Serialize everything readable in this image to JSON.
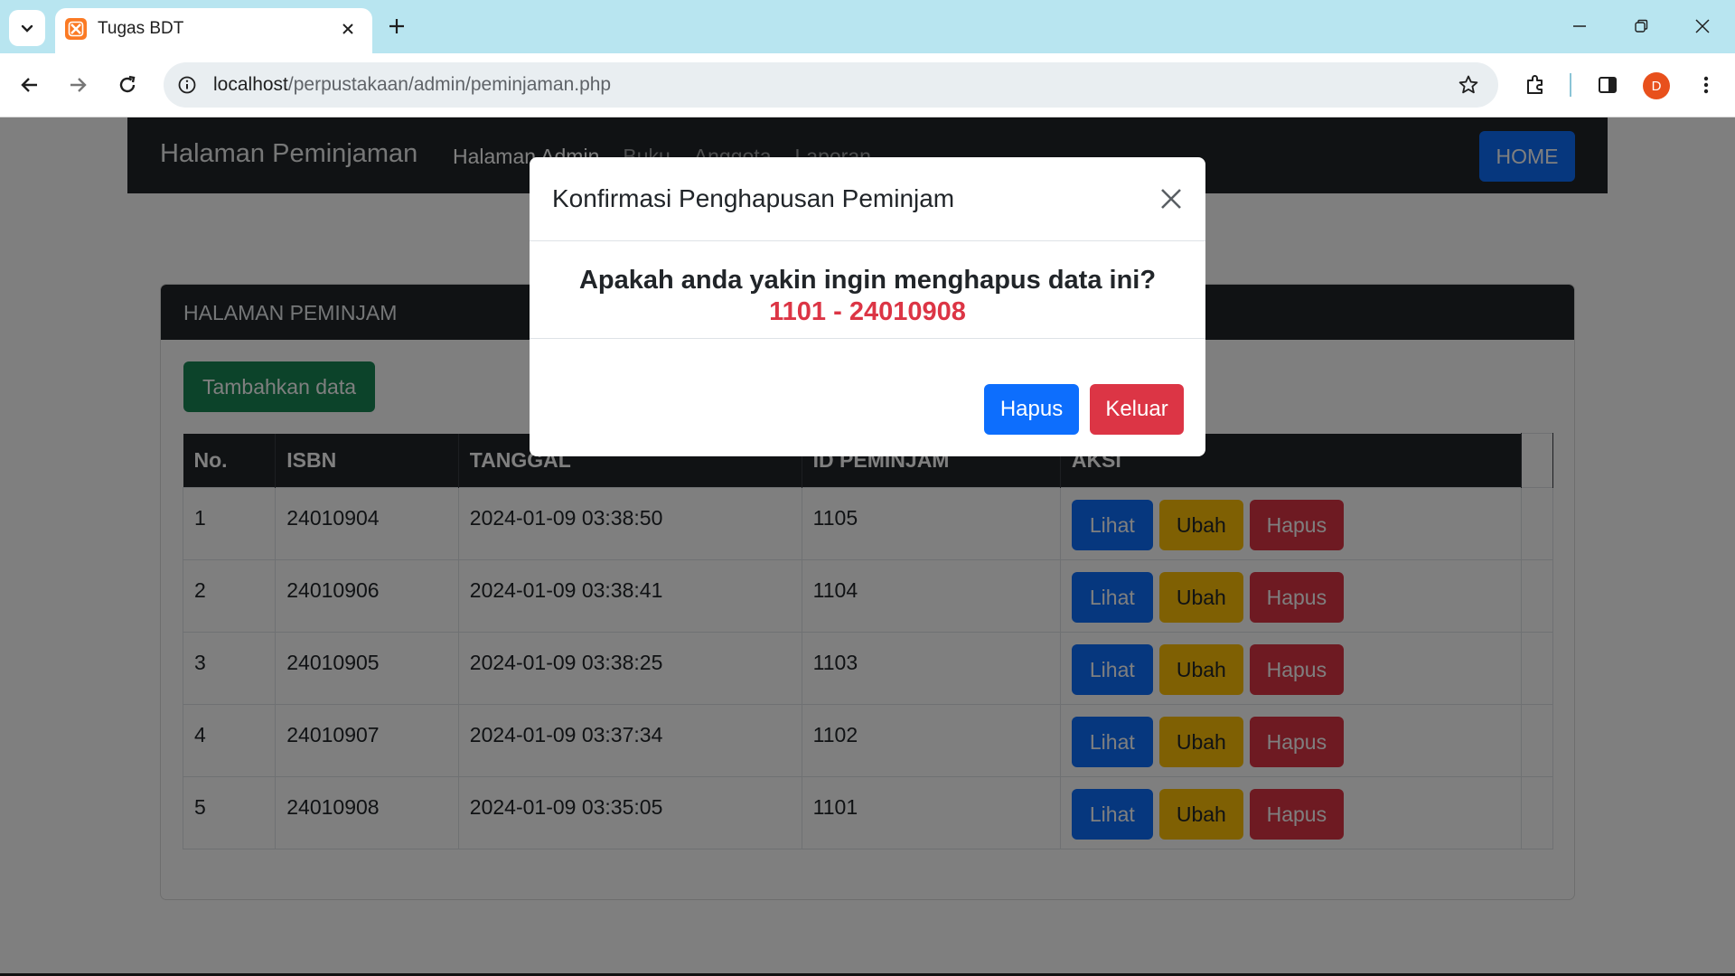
{
  "browser": {
    "tab_title": "Tugas BDT",
    "url_host": "localhost",
    "url_path": "/perpustakaan/admin/peminjaman.php",
    "profile_initial": "D"
  },
  "navbar": {
    "brand": "Halaman Peminjaman",
    "links": [
      "Halaman Admin",
      "Buku",
      "Anggota",
      "Laporan"
    ],
    "home_label": "HOME"
  },
  "card": {
    "title": "HALAMAN PEMINJAM",
    "add_label": "Tambahkan data"
  },
  "table": {
    "headers": [
      "No.",
      "ISBN",
      "TANGGAL",
      "ID PEMINJAM",
      "AKSI"
    ],
    "rows": [
      [
        "1",
        "24010904",
        "2024-01-09 03:38:50",
        "1105"
      ],
      [
        "2",
        "24010906",
        "2024-01-09 03:38:41",
        "1104"
      ],
      [
        "3",
        "24010905",
        "2024-01-09 03:38:25",
        "1103"
      ],
      [
        "4",
        "24010907",
        "2024-01-09 03:37:34",
        "1102"
      ],
      [
        "5",
        "24010908",
        "2024-01-09 03:35:05",
        "1101"
      ]
    ],
    "action_labels": {
      "view": "Lihat",
      "edit": "Ubah",
      "delete": "Hapus"
    }
  },
  "modal": {
    "title": "Konfirmasi Penghapusan Peminjam",
    "question": "Apakah anda yakin ingin menghapus data ini?",
    "record": "1101 - 24010908",
    "confirm_label": "Hapus",
    "cancel_label": "Keluar"
  },
  "colors": {
    "primary": "#0d6efd",
    "success": "#198754",
    "warning": "#ffc107",
    "danger": "#dc3545",
    "dark": "#212529"
  },
  "icons": [
    "tab-search-icon",
    "favicon-icon",
    "close-icon",
    "plus-icon",
    "minimize-icon",
    "restore-icon",
    "back-arrow-icon",
    "forward-arrow-icon",
    "reload-icon",
    "info-icon",
    "star-icon",
    "extensions-icon",
    "side-panel-icon",
    "kebab-menu-icon"
  ]
}
